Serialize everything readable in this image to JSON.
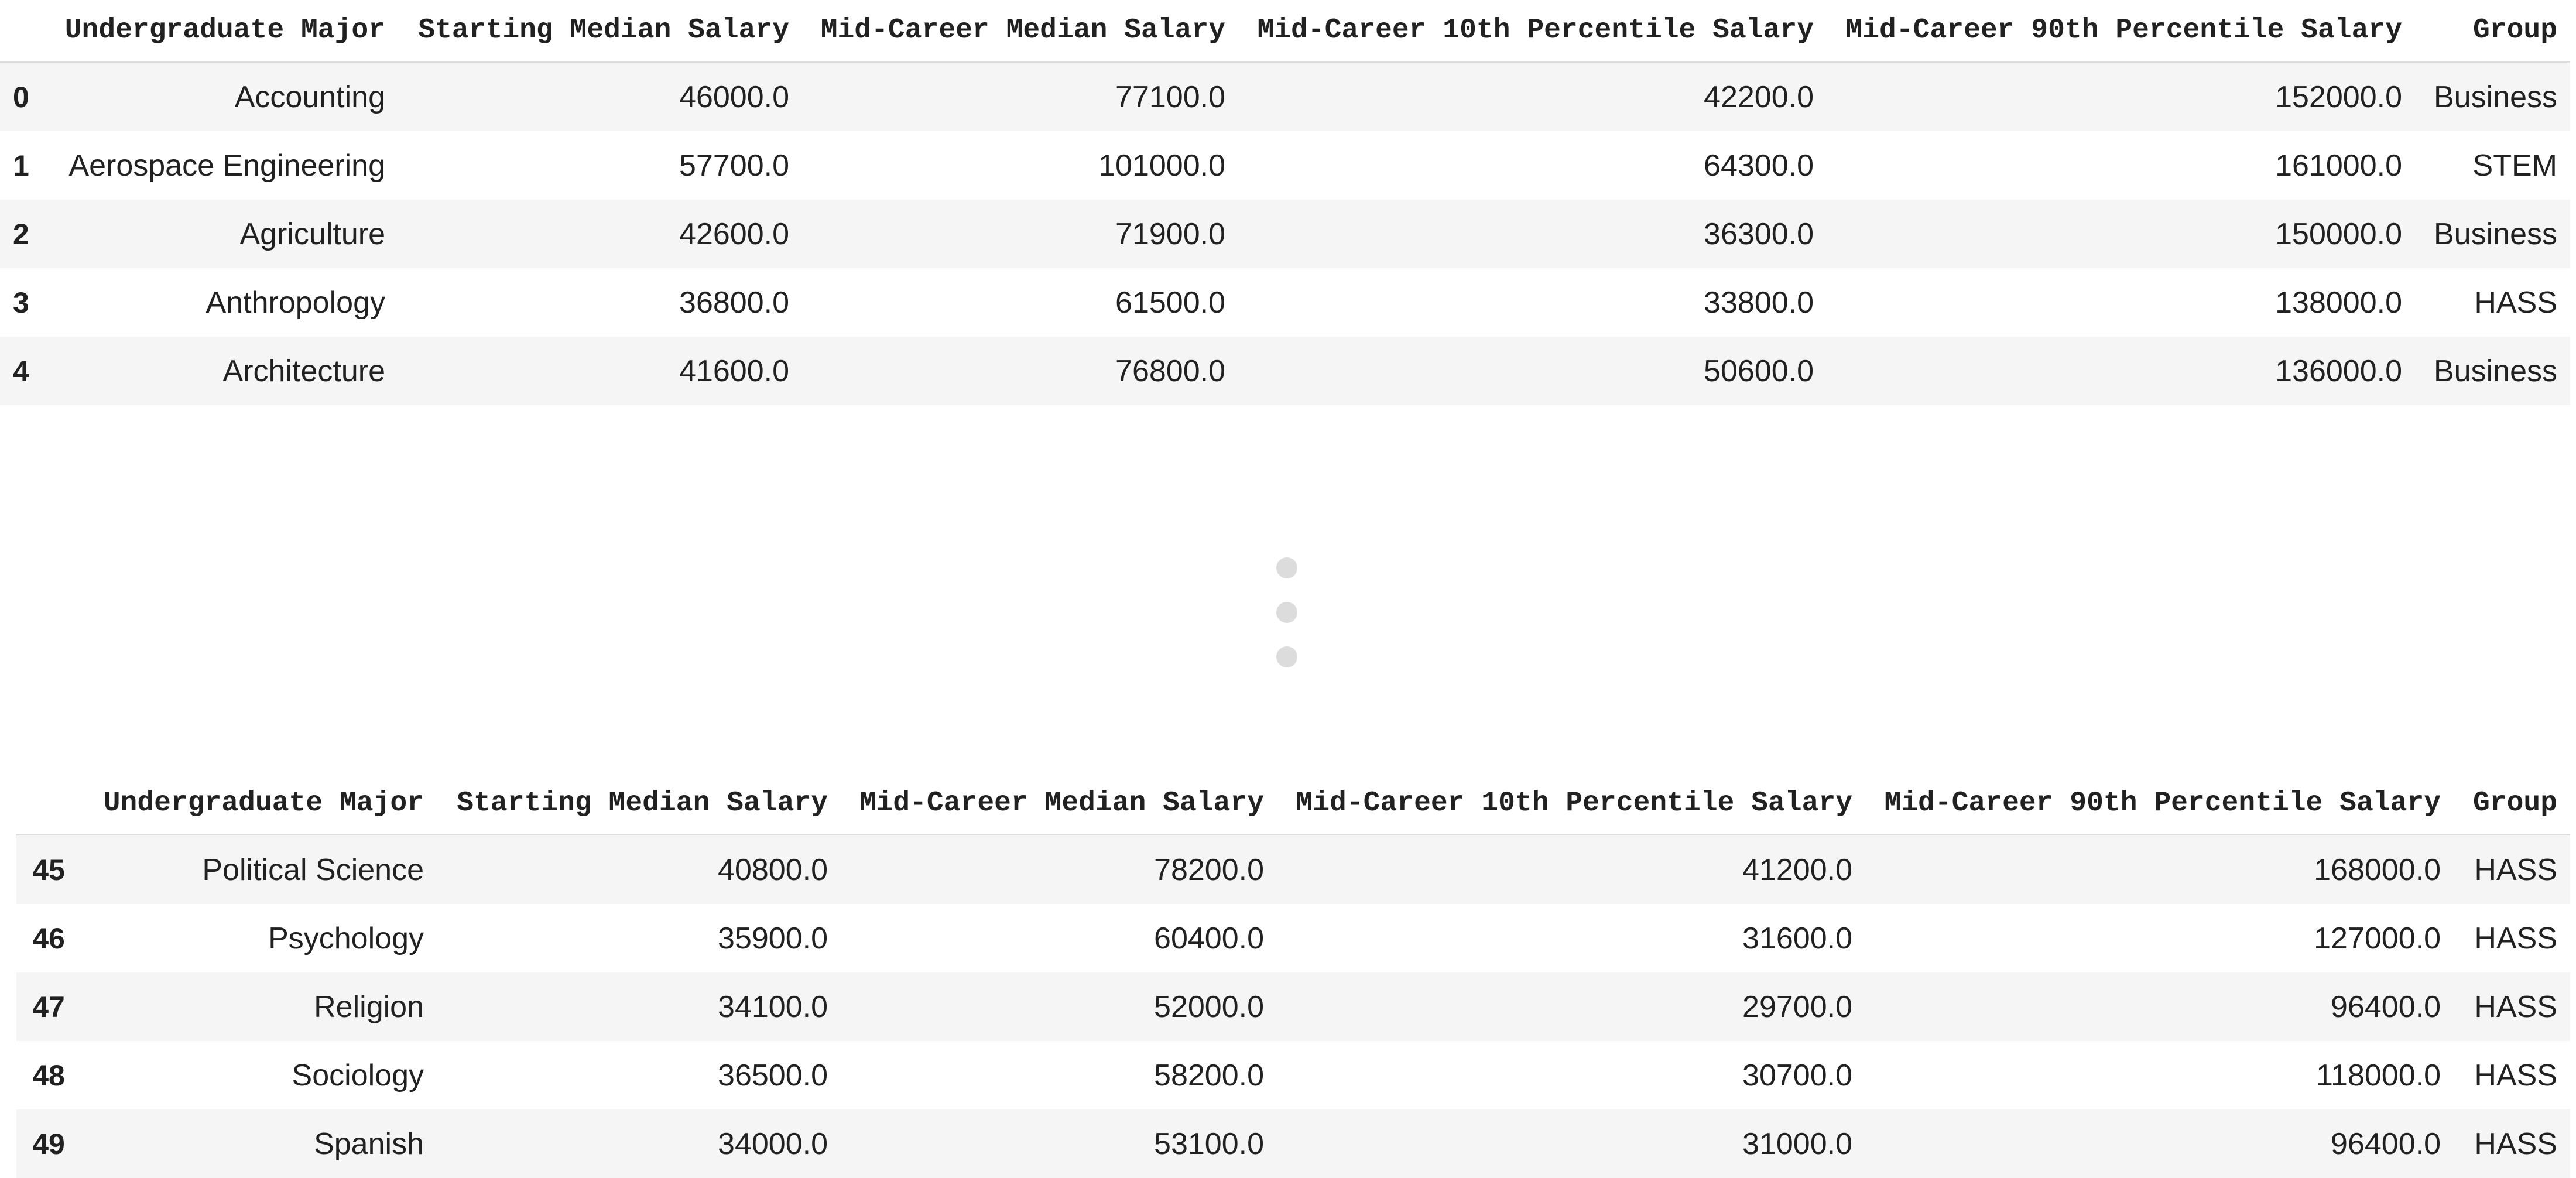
{
  "dataframe": {
    "columns": [
      "",
      "Undergraduate Major",
      "Starting Median Salary",
      "Mid-Career Median Salary",
      "Mid-Career 10th Percentile Salary",
      "Mid-Career 90th Percentile Salary",
      "Group"
    ],
    "head_rows": [
      {
        "index": "0",
        "major": "Accounting",
        "start": "46000.0",
        "mid": "77100.0",
        "p10": "42200.0",
        "p90": "152000.0",
        "group": "Business"
      },
      {
        "index": "1",
        "major": "Aerospace Engineering",
        "start": "57700.0",
        "mid": "101000.0",
        "p10": "64300.0",
        "p90": "161000.0",
        "group": "STEM"
      },
      {
        "index": "2",
        "major": "Agriculture",
        "start": "42600.0",
        "mid": "71900.0",
        "p10": "36300.0",
        "p90": "150000.0",
        "group": "Business"
      },
      {
        "index": "3",
        "major": "Anthropology",
        "start": "36800.0",
        "mid": "61500.0",
        "p10": "33800.0",
        "p90": "138000.0",
        "group": "HASS"
      },
      {
        "index": "4",
        "major": "Architecture",
        "start": "41600.0",
        "mid": "76800.0",
        "p10": "50600.0",
        "p90": "136000.0",
        "group": "Business"
      }
    ],
    "tail_rows": [
      {
        "index": "45",
        "major": "Political Science",
        "start": "40800.0",
        "mid": "78200.0",
        "p10": "41200.0",
        "p90": "168000.0",
        "group": "HASS"
      },
      {
        "index": "46",
        "major": "Psychology",
        "start": "35900.0",
        "mid": "60400.0",
        "p10": "31600.0",
        "p90": "127000.0",
        "group": "HASS"
      },
      {
        "index": "47",
        "major": "Religion",
        "start": "34100.0",
        "mid": "52000.0",
        "p10": "29700.0",
        "p90": "96400.0",
        "group": "HASS"
      },
      {
        "index": "48",
        "major": "Sociology",
        "start": "36500.0",
        "mid": "58200.0",
        "p10": "30700.0",
        "p90": "118000.0",
        "group": "HASS"
      },
      {
        "index": "49",
        "major": "Spanish",
        "start": "34000.0",
        "mid": "53100.0",
        "p10": "31000.0",
        "p90": "96400.0",
        "group": "HASS"
      }
    ]
  },
  "ellipsis_icon": "vertical-ellipsis-icon"
}
